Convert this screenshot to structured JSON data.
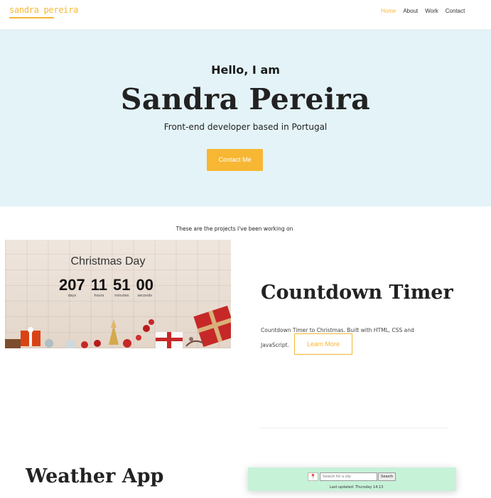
{
  "nav": {
    "logo": "sandra pereira",
    "links": [
      "Home",
      "About",
      "Work",
      "Contact"
    ]
  },
  "hero": {
    "greeting": "Hello, I am",
    "name": "Sandra Pereira",
    "tagline": "Front-end developer based in Portugal",
    "cta": "Contact Me"
  },
  "projects_intro": "These are the projects I've been working on",
  "project1": {
    "image": {
      "title": "Christmas Day",
      "units": [
        {
          "value": "207",
          "label": "days"
        },
        {
          "value": "11",
          "label": "hours"
        },
        {
          "value": "51",
          "label": "minutes"
        },
        {
          "value": "00",
          "label": "seconds"
        }
      ]
    },
    "title": "Countdown Timer",
    "description": "Countdown Timer to Christmas. Built with HTML, CSS and JavaScript.",
    "button": "Learn More"
  },
  "project2": {
    "title": "Weather App",
    "preview": {
      "search_placeholder": "Search for a city",
      "search_button": "Search",
      "updated": "Last updated: Thursday 14:13"
    }
  },
  "colors": {
    "accent": "#f7b733",
    "hero_bg": "#e4f3f7",
    "weather_bg": "#c6f2d8"
  }
}
